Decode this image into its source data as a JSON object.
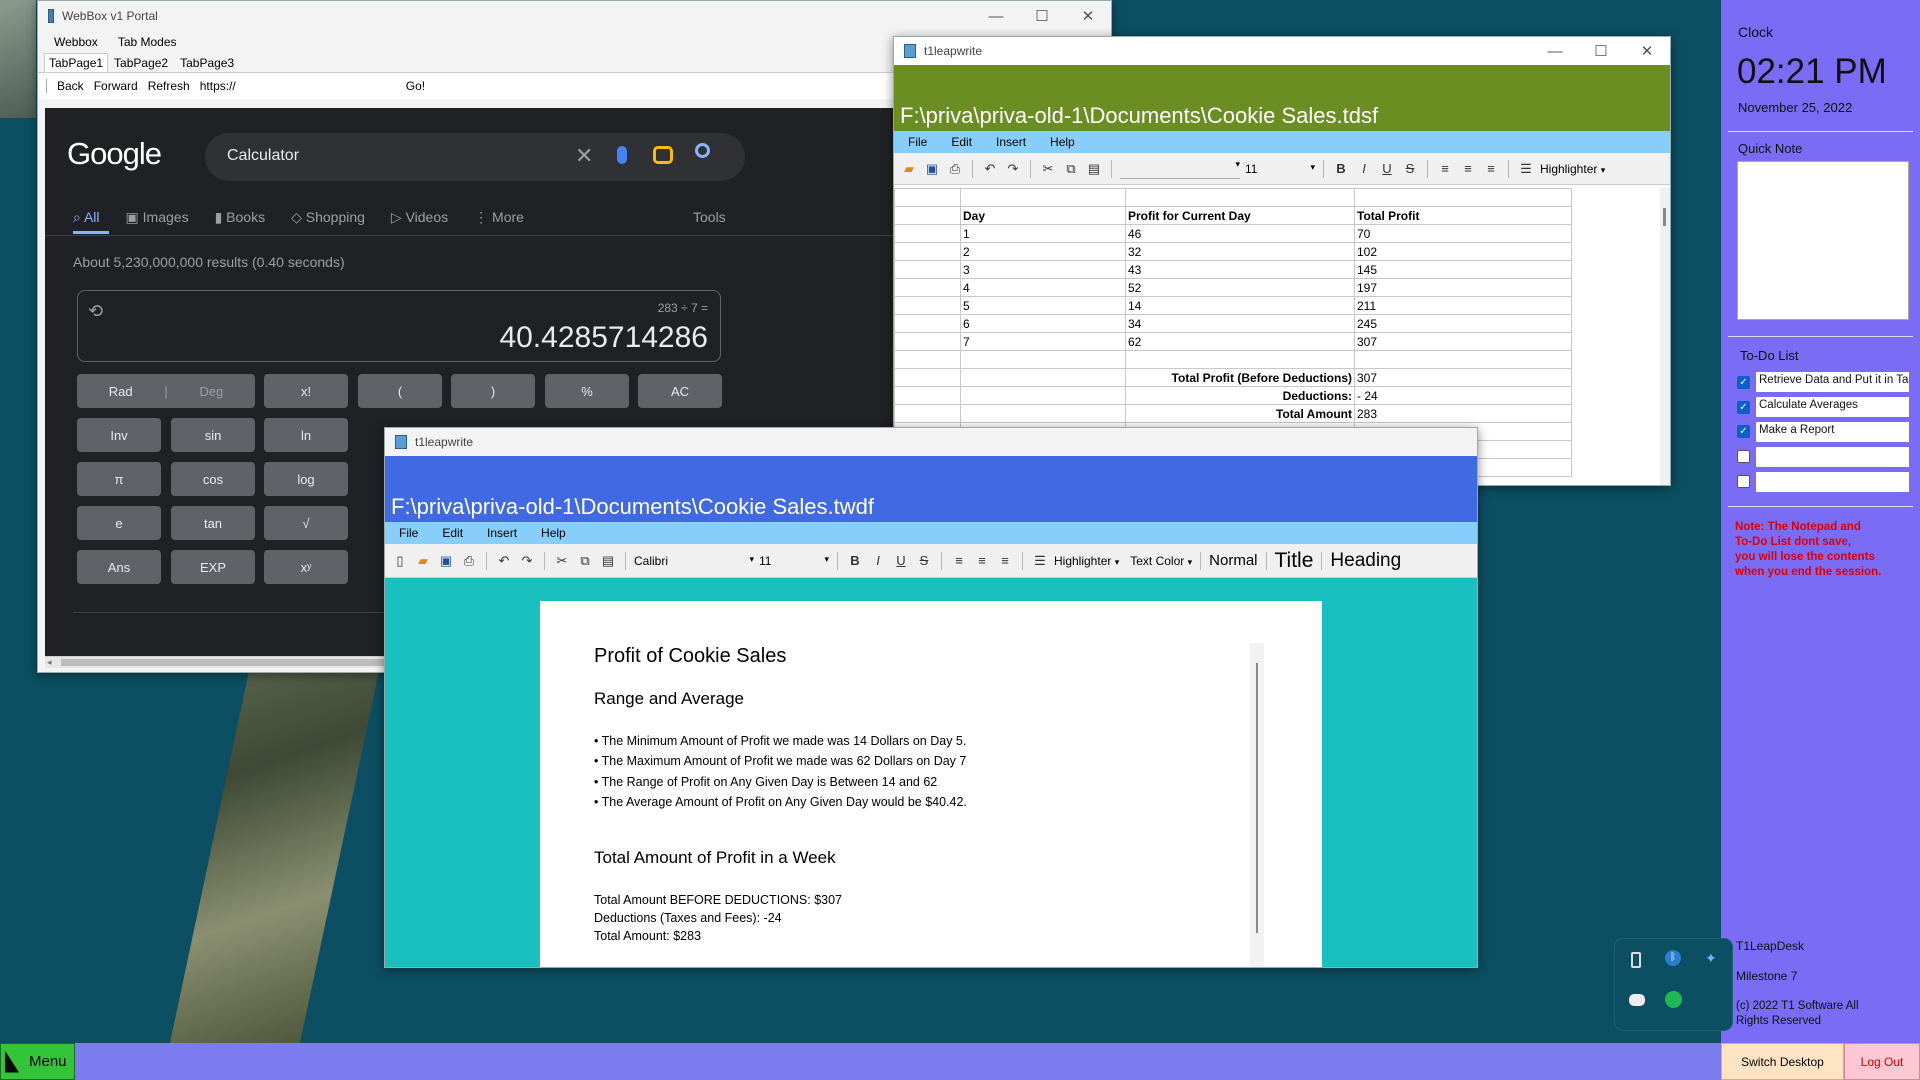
{
  "webbox": {
    "title": "WebBox v1 Portal",
    "menu": [
      "Webbox",
      "Tab Modes"
    ],
    "tabs": [
      "TabPage1",
      "TabPage2",
      "TabPage3"
    ],
    "nav": {
      "back": "Back",
      "forward": "Forward",
      "refresh": "Refresh",
      "url": "https://",
      "go": "Go!"
    }
  },
  "google": {
    "logo": "Google",
    "query": "Calculator",
    "tabs": [
      "All",
      "Images",
      "Books",
      "Shopping",
      "Videos",
      "More"
    ],
    "tools": "Tools",
    "results": "About 5,230,000,000 results (0.40 seconds)",
    "calc": {
      "expression": "283 ÷ 7 =",
      "result": "40.4285714286",
      "rad": "Rad",
      "deg": "Deg",
      "keys": [
        [
          "x!",
          "(",
          ")",
          "%",
          "AC"
        ],
        [
          "Inv",
          "sin",
          "ln"
        ],
        [
          "π",
          "cos",
          "log"
        ],
        [
          "e",
          "tan",
          "√"
        ],
        [
          "Ans",
          "EXP",
          "xʸ"
        ]
      ]
    }
  },
  "spreadsheet": {
    "title": "t1leapwrite",
    "path": "F:\\priva\\priva-old-1\\Documents\\Cookie Sales.tdsf",
    "menu": [
      "File",
      "Edit",
      "Insert",
      "Help"
    ],
    "font_size": "11",
    "highlighter": "Highlighter",
    "headers": [
      "Day",
      "Profit for Current Day",
      "Total Profit"
    ],
    "rows": [
      [
        "1",
        "46",
        "70"
      ],
      [
        "2",
        "32",
        "102"
      ],
      [
        "3",
        "43",
        "145"
      ],
      [
        "4",
        "52",
        "197"
      ],
      [
        "5",
        "14",
        "211"
      ],
      [
        "6",
        "34",
        "245"
      ],
      [
        "7",
        "62",
        "307"
      ]
    ],
    "summary": [
      [
        "Total Profit (Before Deductions)",
        "307"
      ],
      [
        "Deductions:",
        "- 24"
      ],
      [
        "Total Amount",
        "283"
      ]
    ]
  },
  "writer": {
    "title": "t1leapwrite",
    "path": "F:\\priva\\priva-old-1\\Documents\\Cookie Sales.twdf",
    "menu": [
      "File",
      "Edit",
      "Insert",
      "Help"
    ],
    "font": "Calibri",
    "font_size": "11",
    "highlighter": "Highlighter",
    "text_color": "Text Color",
    "styles": [
      "Normal",
      "Title",
      "Heading"
    ],
    "doc": {
      "h1": "Profit of Cookie Sales",
      "h2": "Range and Average",
      "bullets": [
        "The Minimum Amount of Profit we made was 14 Dollars on Day 5.",
        "The Maximum Amount of Profit we made was 62 Dollars on Day 7",
        "The Range of Profit on Any Given Day is Between 14 and 62",
        "The Average Amount of Profit on Any Given Day would be $40.42."
      ],
      "h3": "Total Amount of Profit in a Week",
      "lines": [
        "Total Amount BEFORE DEDUCTIONS: $307",
        "Deductions (Taxes and Fees): -24",
        "Total Amount: $283"
      ]
    }
  },
  "sidebar": {
    "clock_label": "Clock",
    "time": "02:21 PM",
    "date": "November 25, 2022",
    "note_label": "Quick Note",
    "todo_label": "To-Do List",
    "todos": [
      {
        "text": "Retrieve Data and Put it in Ta",
        "checked": true
      },
      {
        "text": "Calculate Averages",
        "checked": true
      },
      {
        "text": "Make a Report",
        "checked": true
      },
      {
        "text": "",
        "checked": false
      },
      {
        "text": "",
        "checked": false
      }
    ],
    "warning": [
      "Note: The Notepad and",
      "To-Do List dont save,",
      "you will lose the contents",
      "when you end the session."
    ],
    "brand": "T1LeapDesk",
    "milestone": "Milestone 7",
    "copyright": "(c) 2022 T1 Software All Rights Reserved",
    "switch_desktop": "Switch Desktop",
    "logout": "Log Out"
  },
  "taskbar": {
    "menu": "Menu"
  },
  "colors": {
    "desktop": "#0c4f62",
    "sidebar": "#7b6cf5",
    "taskbar": "#7b7cf0",
    "sheet_header": "#6b8e23",
    "writer_header": "#4169e1",
    "writer_bg": "#19c0c0"
  }
}
